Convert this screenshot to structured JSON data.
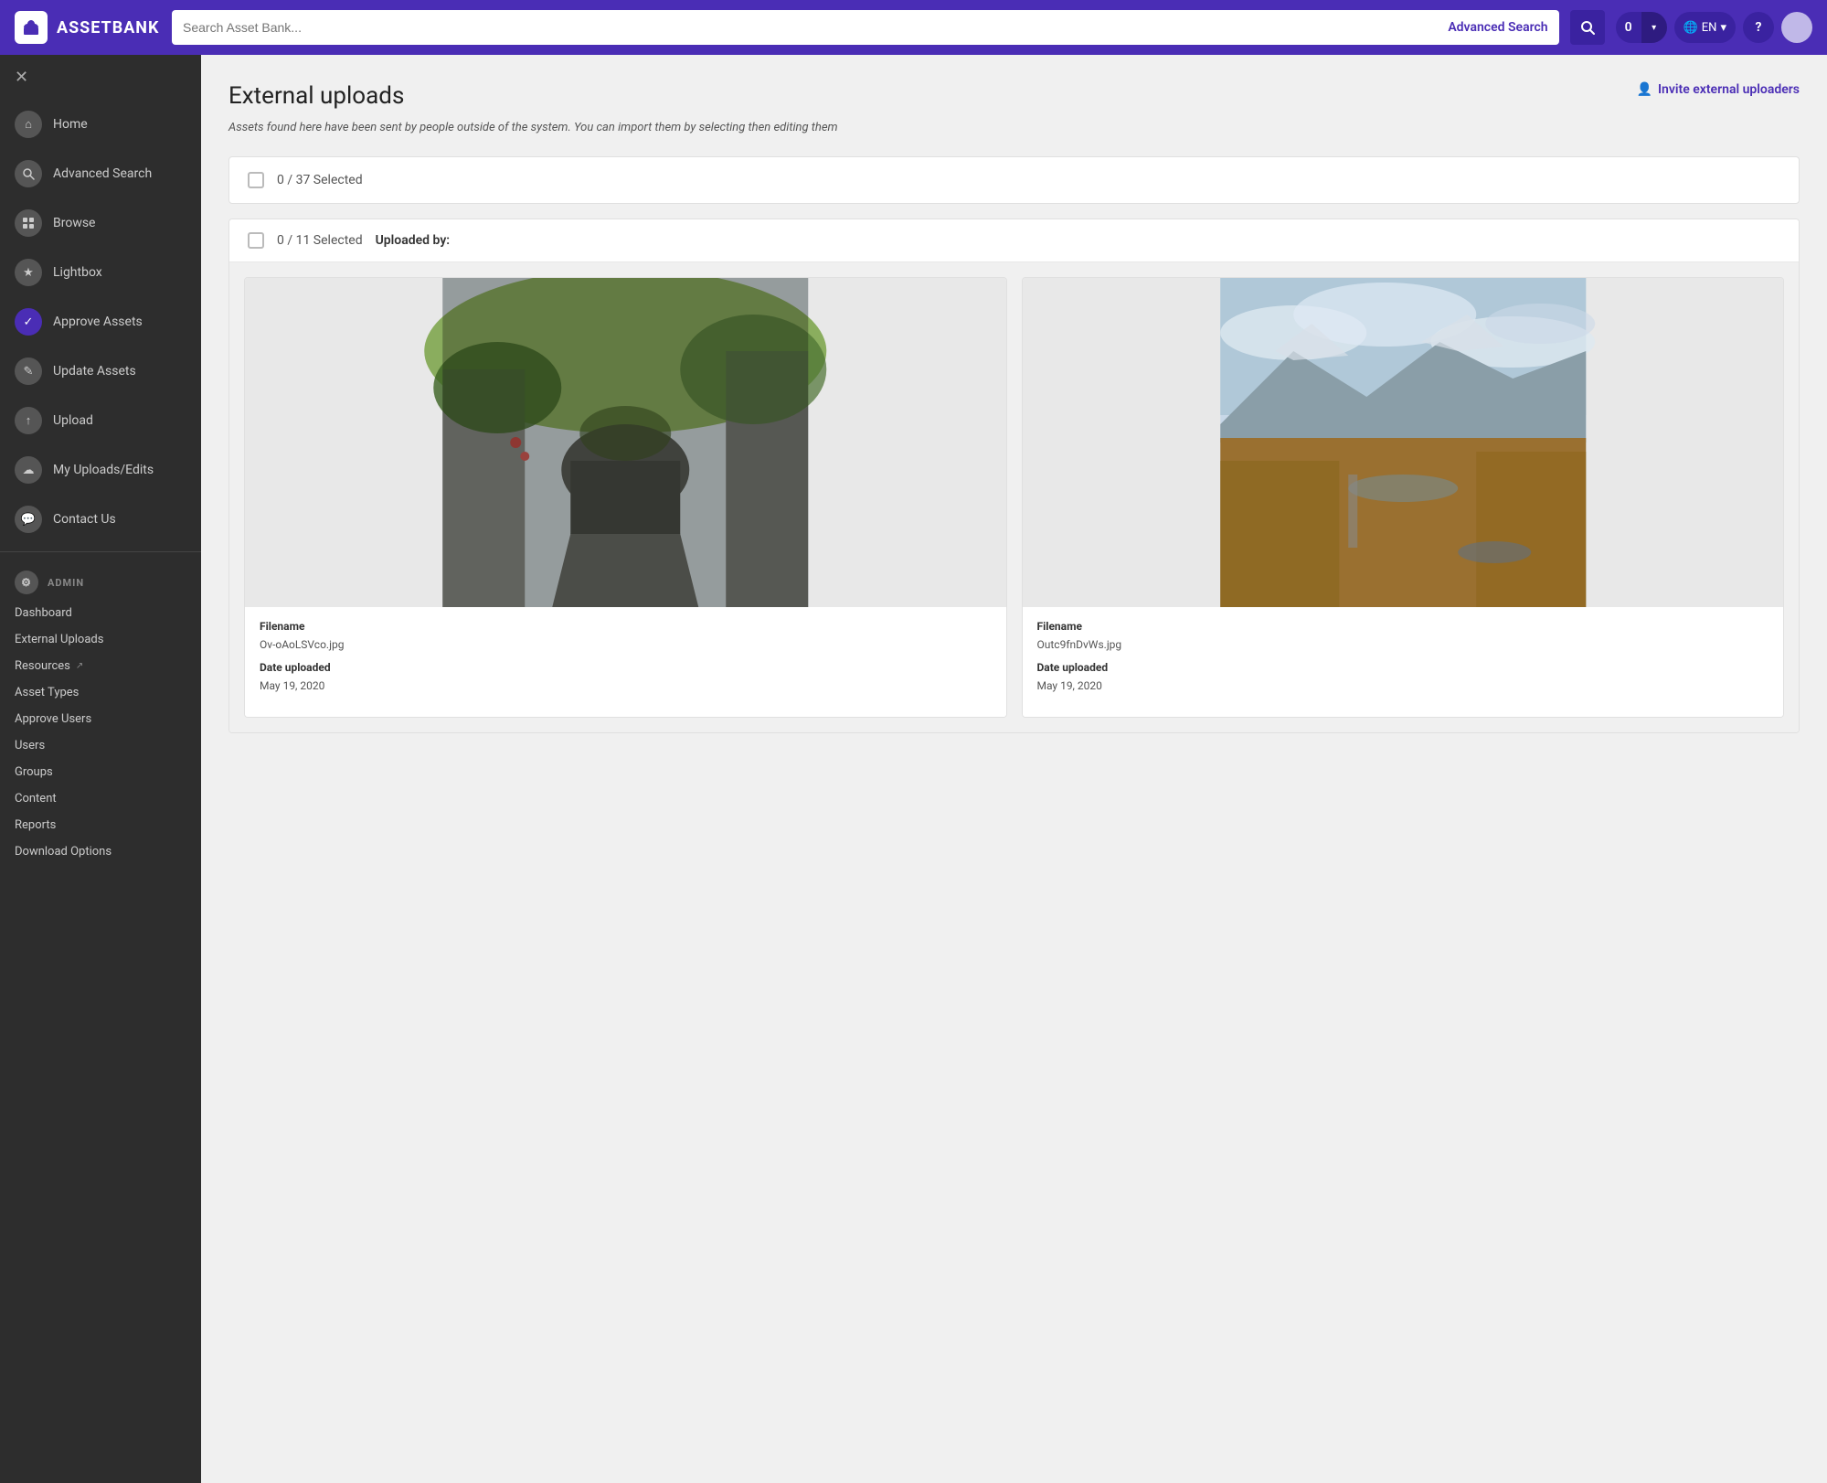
{
  "app": {
    "name": "ASSETBANK"
  },
  "topnav": {
    "search_placeholder": "Search Asset Bank...",
    "advanced_search_label": "Advanced Search",
    "cart_count": "0",
    "lang_label": "EN",
    "help_label": "?"
  },
  "sidebar": {
    "nav_items": [
      {
        "id": "home",
        "label": "Home",
        "icon": "⌂"
      },
      {
        "id": "advanced-search",
        "label": "Advanced Search",
        "icon": "🔍"
      },
      {
        "id": "browse",
        "label": "Browse",
        "icon": "📁"
      },
      {
        "id": "lightbox",
        "label": "Lightbox",
        "icon": "★"
      },
      {
        "id": "approve-assets",
        "label": "Approve Assets",
        "icon": "✓",
        "active": true
      },
      {
        "id": "update-assets",
        "label": "Update Assets",
        "icon": "✎"
      },
      {
        "id": "upload",
        "label": "Upload",
        "icon": "↑"
      },
      {
        "id": "my-uploads",
        "label": "My Uploads/Edits",
        "icon": "☁"
      },
      {
        "id": "contact-us",
        "label": "Contact Us",
        "icon": "💬"
      }
    ],
    "admin_label": "ADMIN",
    "admin_links": [
      {
        "id": "dashboard",
        "label": "Dashboard",
        "external": false
      },
      {
        "id": "external-uploads",
        "label": "External Uploads",
        "external": false
      },
      {
        "id": "resources",
        "label": "Resources",
        "external": true
      },
      {
        "id": "asset-types",
        "label": "Asset Types",
        "external": false
      },
      {
        "id": "approve-users",
        "label": "Approve Users",
        "external": false
      },
      {
        "id": "users",
        "label": "Users",
        "external": false
      },
      {
        "id": "groups",
        "label": "Groups",
        "external": false
      },
      {
        "id": "content",
        "label": "Content",
        "external": false
      },
      {
        "id": "reports",
        "label": "Reports",
        "external": false
      },
      {
        "id": "download-options",
        "label": "Download Options",
        "external": false
      }
    ]
  },
  "main": {
    "page_title": "External uploads",
    "page_desc_part1": "Assets found here have been sent by people outside of the system. You can import them by",
    "page_desc_italic1": "selecting",
    "page_desc_part2": "then",
    "page_desc_italic2": "editing",
    "page_desc_part3": "them",
    "invite_label": "Invite external uploaders",
    "total_selection_label": "0 / 37 Selected",
    "group": {
      "selection_label": "0 / 11 Selected",
      "uploaded_by_label": "Uploaded by:",
      "assets": [
        {
          "id": "asset-1",
          "filename_label": "Filename",
          "filename": "Ov-oAoLSVco.jpg",
          "date_label": "Date uploaded",
          "date": "May 19, 2020",
          "image_type": "alley"
        },
        {
          "id": "asset-2",
          "filename_label": "Filename",
          "filename": "Outc9fnDvWs.jpg",
          "date_label": "Date uploaded",
          "date": "May 19, 2020",
          "image_type": "landscape"
        }
      ]
    }
  }
}
